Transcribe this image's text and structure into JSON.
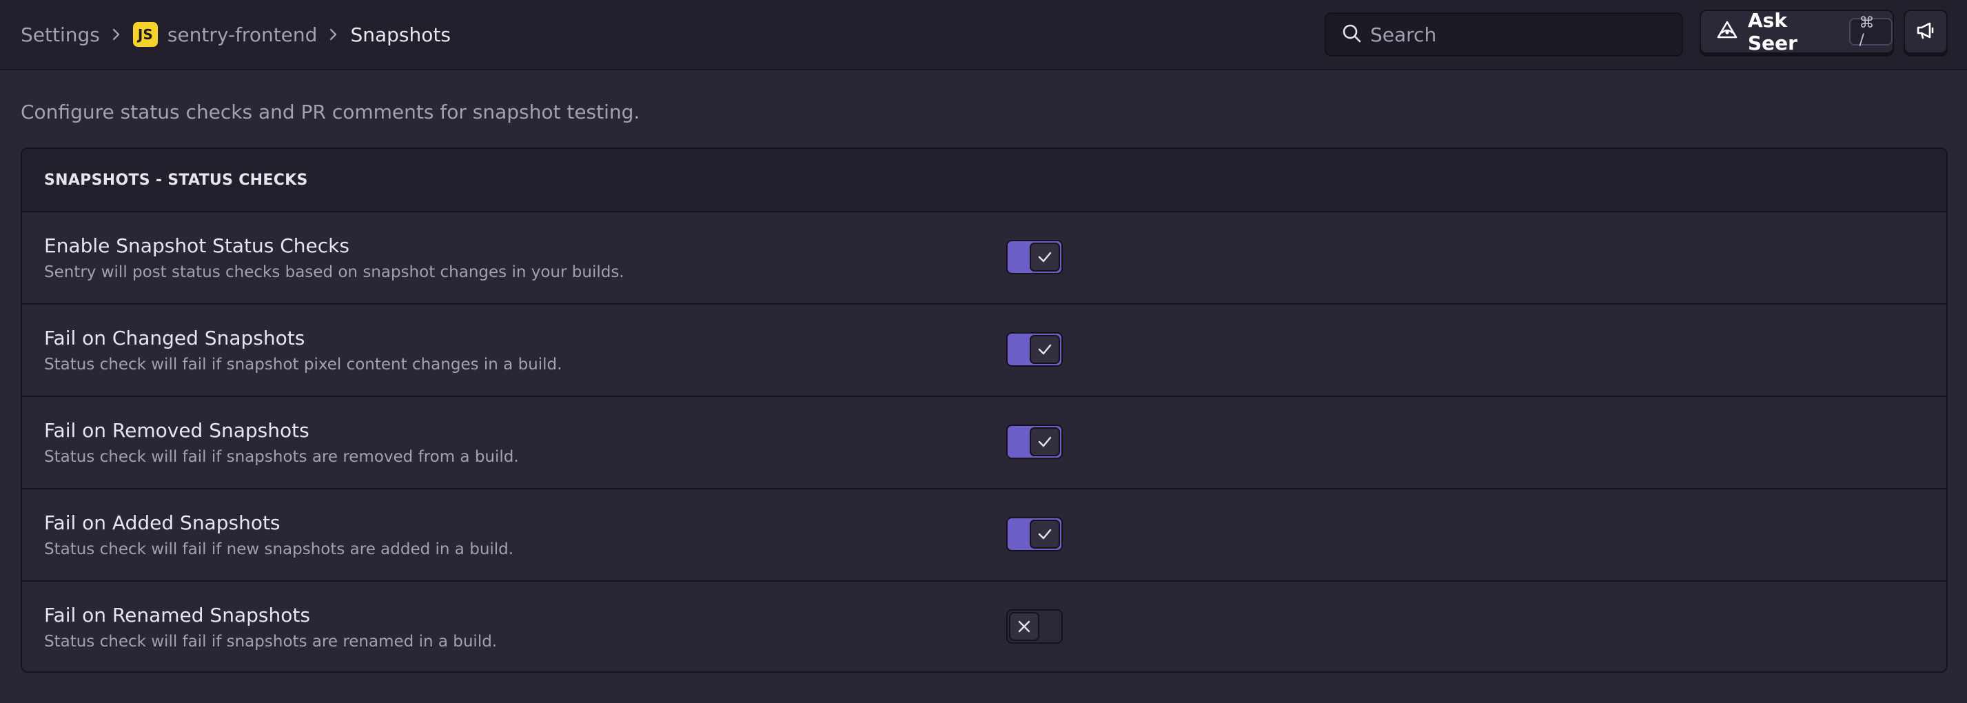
{
  "breadcrumb": {
    "settings": "Settings",
    "project_badge": "JS",
    "project": "sentry-frontend",
    "current": "Snapshots"
  },
  "search": {
    "placeholder": "Search"
  },
  "ask_seer": {
    "label": "Ask Seer",
    "shortcut": "⌘ /"
  },
  "page": {
    "description": "Configure status checks and PR comments for snapshot testing."
  },
  "panel": {
    "title": "SNAPSHOTS - STATUS CHECKS",
    "rows": [
      {
        "title": "Enable Snapshot Status Checks",
        "help": "Sentry will post status checks based on snapshot changes in your builds.",
        "enabled": true
      },
      {
        "title": "Fail on Changed Snapshots",
        "help": "Status check will fail if snapshot pixel content changes in a build.",
        "enabled": true
      },
      {
        "title": "Fail on Removed Snapshots",
        "help": "Status check will fail if snapshots are removed from a build.",
        "enabled": true
      },
      {
        "title": "Fail on Added Snapshots",
        "help": "Status check will fail if new snapshots are added in a build.",
        "enabled": true
      },
      {
        "title": "Fail on Renamed Snapshots",
        "help": "Status check will fail if snapshots are renamed in a build.",
        "enabled": false
      }
    ]
  },
  "colors": {
    "accent": "#6c5fc7",
    "background": "#2b2635",
    "header": "#231f2d",
    "js_badge": "#f5d32a"
  },
  "icons": {
    "search": "search-icon",
    "seer": "seer-eye-icon",
    "announce": "megaphone-icon",
    "toggle_on": "check-icon",
    "toggle_off": "close-icon",
    "separator": "chevron-right-icon"
  }
}
